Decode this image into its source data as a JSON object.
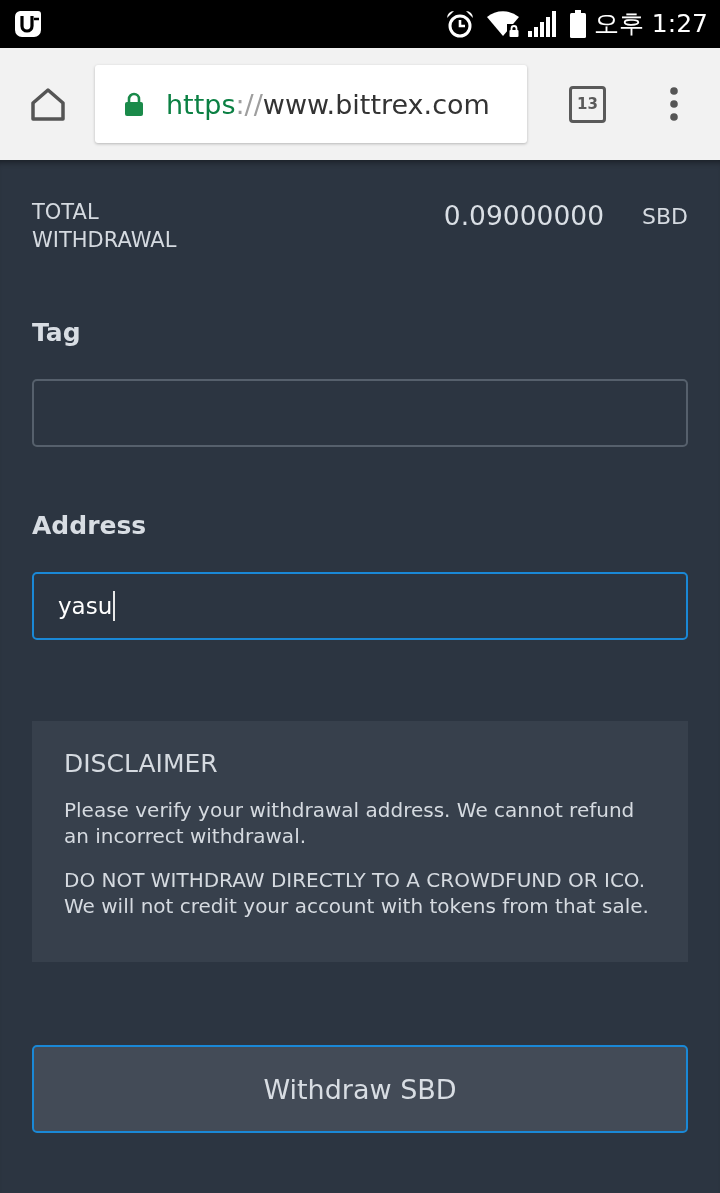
{
  "status_bar": {
    "time": "오후 1:27"
  },
  "browser_toolbar": {
    "url": {
      "scheme": "https",
      "separator": "://",
      "host": "www.bittrex.com"
    },
    "tab_count": "13"
  },
  "withdrawal_summary": {
    "label": "TOTAL WITHDRAWAL",
    "amount": "0.09000000",
    "currency": "SBD"
  },
  "fields": [
    {
      "label": "Tag",
      "focused": false
    },
    {
      "label": "Address",
      "value": "yasu",
      "focused": true
    }
  ],
  "disclaimer": {
    "title": "DISCLAIMER",
    "paragraphs": [
      "Please verify your withdrawal address. We cannot refund an incorrect withdrawal.",
      "DO NOT WITHDRAW DIRECTLY TO A CROWDFUND OR ICO. We will not credit your account with tokens from that sale."
    ]
  },
  "submit_button": {
    "label": "Withdraw SBD"
  }
}
